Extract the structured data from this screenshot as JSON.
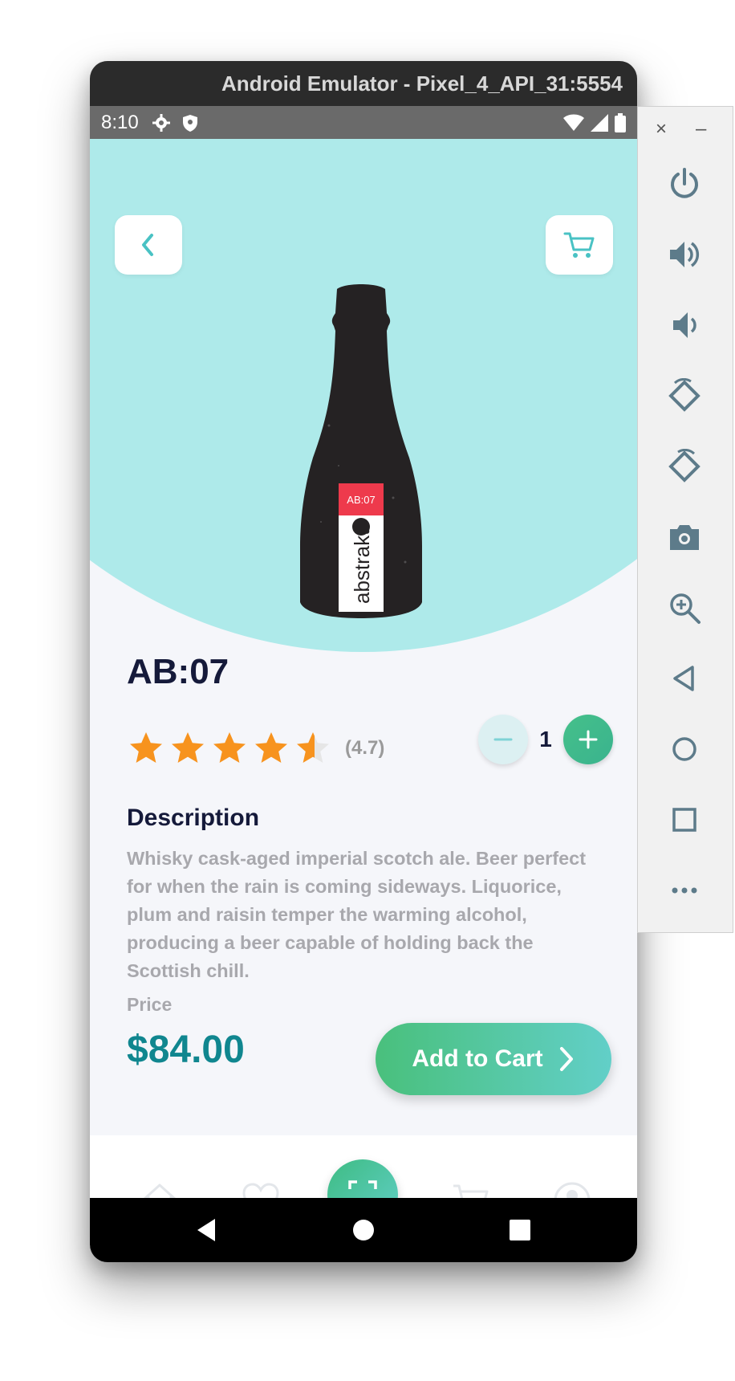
{
  "emulator": {
    "title": "Android Emulator - Pixel_4_API_31:5554",
    "side_panel": {
      "close_label": "×",
      "minimize_label": "–",
      "buttons": [
        "power-icon",
        "volume-up-icon",
        "volume-down-icon",
        "rotate-left-icon",
        "rotate-right-icon",
        "camera-icon",
        "zoom-icon",
        "back-icon",
        "home-icon",
        "overview-icon",
        "more-icon"
      ]
    }
  },
  "status_bar": {
    "time": "8:10"
  },
  "product": {
    "name": "AB:07",
    "rating_label": "(4.7)",
    "rating_value": 4.7,
    "rating_max": 5,
    "quantity": "1",
    "description_heading": "Description",
    "description": "Whisky cask-aged imperial scotch ale. Beer perfect for when the rain is coming sideways. Liquorice, plum and raisin temper the warming alcohol, producing a beer capable of holding back the Scottish chill.",
    "price_label": "Price",
    "price": "$84.00",
    "label_top": "AB:07",
    "label_brand": "abstrakt"
  },
  "actions": {
    "add_to_cart": "Add to Cart"
  },
  "colors": {
    "hero_bg": "#aeeaea",
    "accent_teal": "#10868f",
    "gradient_start": "#49c07c",
    "gradient_end": "#62cfc8",
    "star": "#f7931e"
  }
}
